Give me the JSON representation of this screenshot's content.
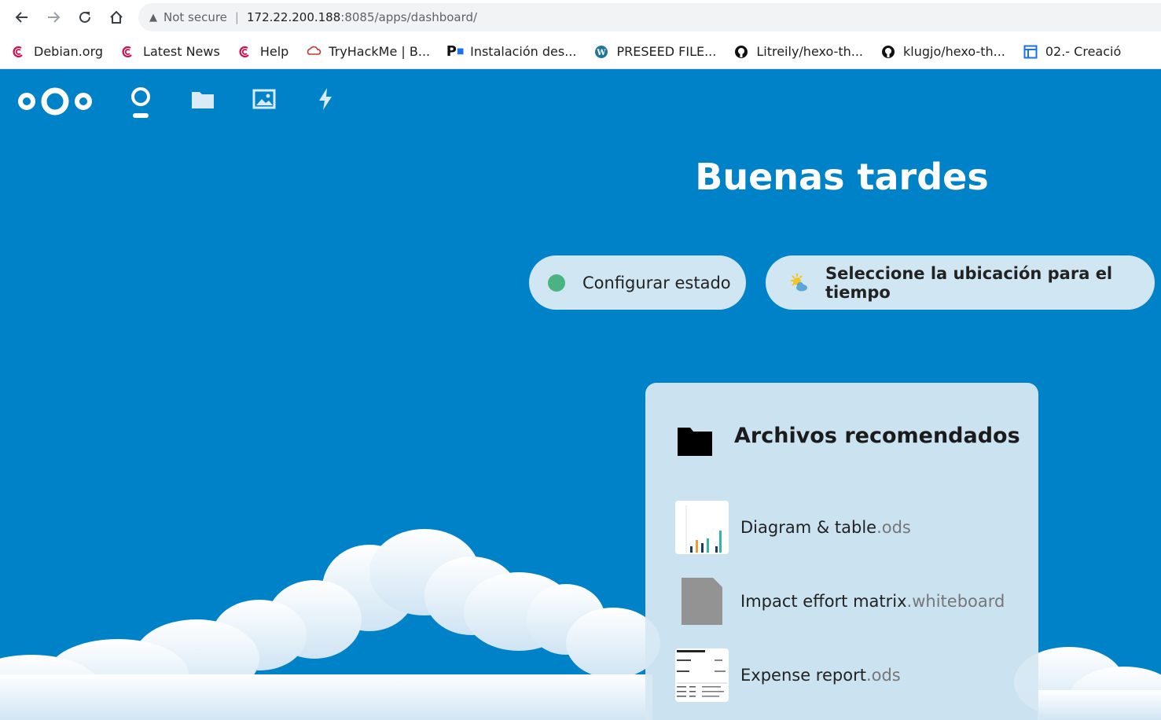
{
  "browser": {
    "security_label": "Not secure",
    "url_host": "172.22.200.188",
    "url_path": ":8085/apps/dashboard/",
    "bookmarks": [
      {
        "label": "Debian.org",
        "icon": "debian-icon"
      },
      {
        "label": "Latest News",
        "icon": "debian-icon"
      },
      {
        "label": "Help",
        "icon": "debian-icon"
      },
      {
        "label": "TryHackMe | B...",
        "icon": "tryhackme-icon"
      },
      {
        "label": "Instalación des...",
        "icon": "p-icon"
      },
      {
        "label": "PRESEED FILE...",
        "icon": "wordpress-icon"
      },
      {
        "label": "Litreily/hexo-th...",
        "icon": "github-icon"
      },
      {
        "label": "klugjo/hexo-th...",
        "icon": "github-icon"
      },
      {
        "label": "02.- Creació",
        "icon": "page-icon"
      }
    ]
  },
  "nextcloud": {
    "greeting": "Buenas tardes",
    "status_button": "Configurar estado",
    "weather_button": "Seleccione la ubicación para el tiempo",
    "widget": {
      "title": "Archivos recomendados",
      "files": [
        {
          "name": "Diagram & table",
          "ext": ".ods"
        },
        {
          "name": "Impact effort matrix",
          "ext": ".whiteboard"
        },
        {
          "name": "Expense report",
          "ext": ".ods"
        }
      ]
    },
    "colors": {
      "primary": "#0082c9",
      "status_online": "#49b382"
    }
  }
}
